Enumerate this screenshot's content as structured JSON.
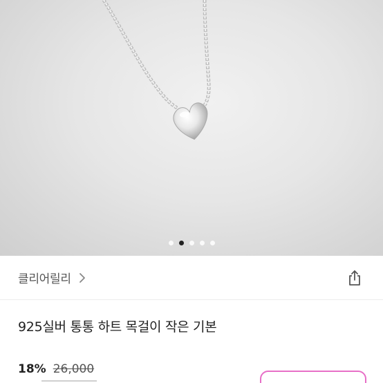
{
  "product": {
    "image_alt_icon": "heart-necklace-photo",
    "carousel": {
      "count": 5,
      "active": 1
    },
    "store_name": "클리어릴리",
    "title": "925실버 통통 하트 목걸이 작은 기본",
    "discount": "18%",
    "original_price": "26,000"
  },
  "colors": {
    "accent": "#e76fc7",
    "text": "#222222",
    "muted": "#555555"
  },
  "icons": {
    "chevron": "chevron-right-icon",
    "share": "share-icon"
  }
}
